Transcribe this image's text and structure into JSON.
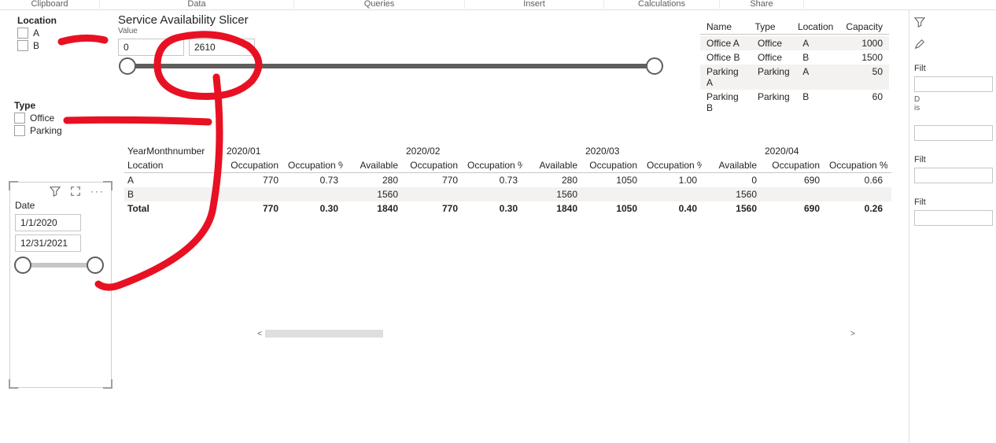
{
  "ribbon": {
    "tabs": [
      "Clipboard",
      "Data",
      "Queries",
      "Insert",
      "Calculations",
      "Share"
    ]
  },
  "location_slicer": {
    "title": "Location",
    "options": [
      "A",
      "B"
    ]
  },
  "type_slicer": {
    "title": "Type",
    "options": [
      "Office",
      "Parking"
    ]
  },
  "value_slicer": {
    "title": "Service Availability Slicer",
    "field": "Value",
    "min": "0",
    "max": "2610"
  },
  "date_slicer": {
    "title": "Date",
    "from": "1/1/2020",
    "to": "12/31/2021"
  },
  "ref_table": {
    "headers": {
      "name": "Name",
      "type": "Type",
      "location": "Location",
      "capacity": "Capacity"
    },
    "rows": [
      {
        "name": "Office A",
        "type": "Office",
        "location": "A",
        "capacity": "1000"
      },
      {
        "name": "Office B",
        "type": "Office",
        "location": "B",
        "capacity": "1500"
      },
      {
        "name": "Parking A",
        "type": "Parking",
        "location": "A",
        "capacity": "50"
      },
      {
        "name": "Parking B",
        "type": "Parking",
        "location": "B",
        "capacity": "60"
      }
    ]
  },
  "matrix": {
    "row_field": "YearMonthnumber",
    "col_field": "Location",
    "periods": [
      "2020/01",
      "2020/02",
      "2020/03",
      "2020/04"
    ],
    "measures": [
      "Occupation",
      "Occupation %",
      "Available"
    ],
    "last_measures": [
      "Occupation",
      "Occupation %"
    ],
    "rows": [
      {
        "label": "A",
        "cells": [
          [
            "770",
            "0.73",
            "280"
          ],
          [
            "770",
            "0.73",
            "280"
          ],
          [
            "1050",
            "1.00",
            "0"
          ],
          [
            "690",
            "0.66"
          ]
        ]
      },
      {
        "label": "B",
        "cells": [
          [
            "",
            "",
            "1560"
          ],
          [
            "",
            "",
            "1560"
          ],
          [
            "",
            "",
            "1560"
          ],
          [
            "",
            ""
          ]
        ]
      },
      {
        "label": "Total",
        "cells": [
          [
            "770",
            "0.30",
            "1840"
          ],
          [
            "770",
            "0.30",
            "1840"
          ],
          [
            "1050",
            "0.40",
            "1560"
          ],
          [
            "690",
            "0.26"
          ]
        ]
      }
    ]
  },
  "right_panel": {
    "filters1": "Filt",
    "row1": "D",
    "row2": "is",
    "filters2": "Filt",
    "filters3": "Filt"
  },
  "scroll": {
    "left": "<",
    "right": ">"
  },
  "chart_data": {
    "type": "table",
    "reference": [
      {
        "Name": "Office A",
        "Type": "Office",
        "Location": "A",
        "Capacity": 1000
      },
      {
        "Name": "Office B",
        "Type": "Office",
        "Location": "B",
        "Capacity": 1500
      },
      {
        "Name": "Parking A",
        "Type": "Parking",
        "Location": "A",
        "Capacity": 50
      },
      {
        "Name": "Parking B",
        "Type": "Parking",
        "Location": "B",
        "Capacity": 60
      }
    ],
    "matrix": {
      "periods": [
        "2020/01",
        "2020/02",
        "2020/03",
        "2020/04"
      ],
      "rows": {
        "A": [
          {
            "Occupation": 770,
            "Occupation %": 0.73,
            "Available": 280
          },
          {
            "Occupation": 770,
            "Occupation %": 0.73,
            "Available": 280
          },
          {
            "Occupation": 1050,
            "Occupation %": 1.0,
            "Available": 0
          },
          {
            "Occupation": 690,
            "Occupation %": 0.66
          }
        ],
        "B": [
          {
            "Occupation": null,
            "Occupation %": null,
            "Available": 1560
          },
          {
            "Occupation": null,
            "Occupation %": null,
            "Available": 1560
          },
          {
            "Occupation": null,
            "Occupation %": null,
            "Available": 1560
          },
          {
            "Occupation": null,
            "Occupation %": null
          }
        ],
        "Total": [
          {
            "Occupation": 770,
            "Occupation %": 0.3,
            "Available": 1840
          },
          {
            "Occupation": 770,
            "Occupation %": 0.3,
            "Available": 1840
          },
          {
            "Occupation": 1050,
            "Occupation %": 0.4,
            "Available": 1560
          },
          {
            "Occupation": 690,
            "Occupation %": 0.26
          }
        ]
      }
    },
    "slicer_range": {
      "field": "Value",
      "min": 0,
      "max": 2610
    },
    "date_range": {
      "from": "2020-01-01",
      "to": "2021-12-31"
    }
  }
}
